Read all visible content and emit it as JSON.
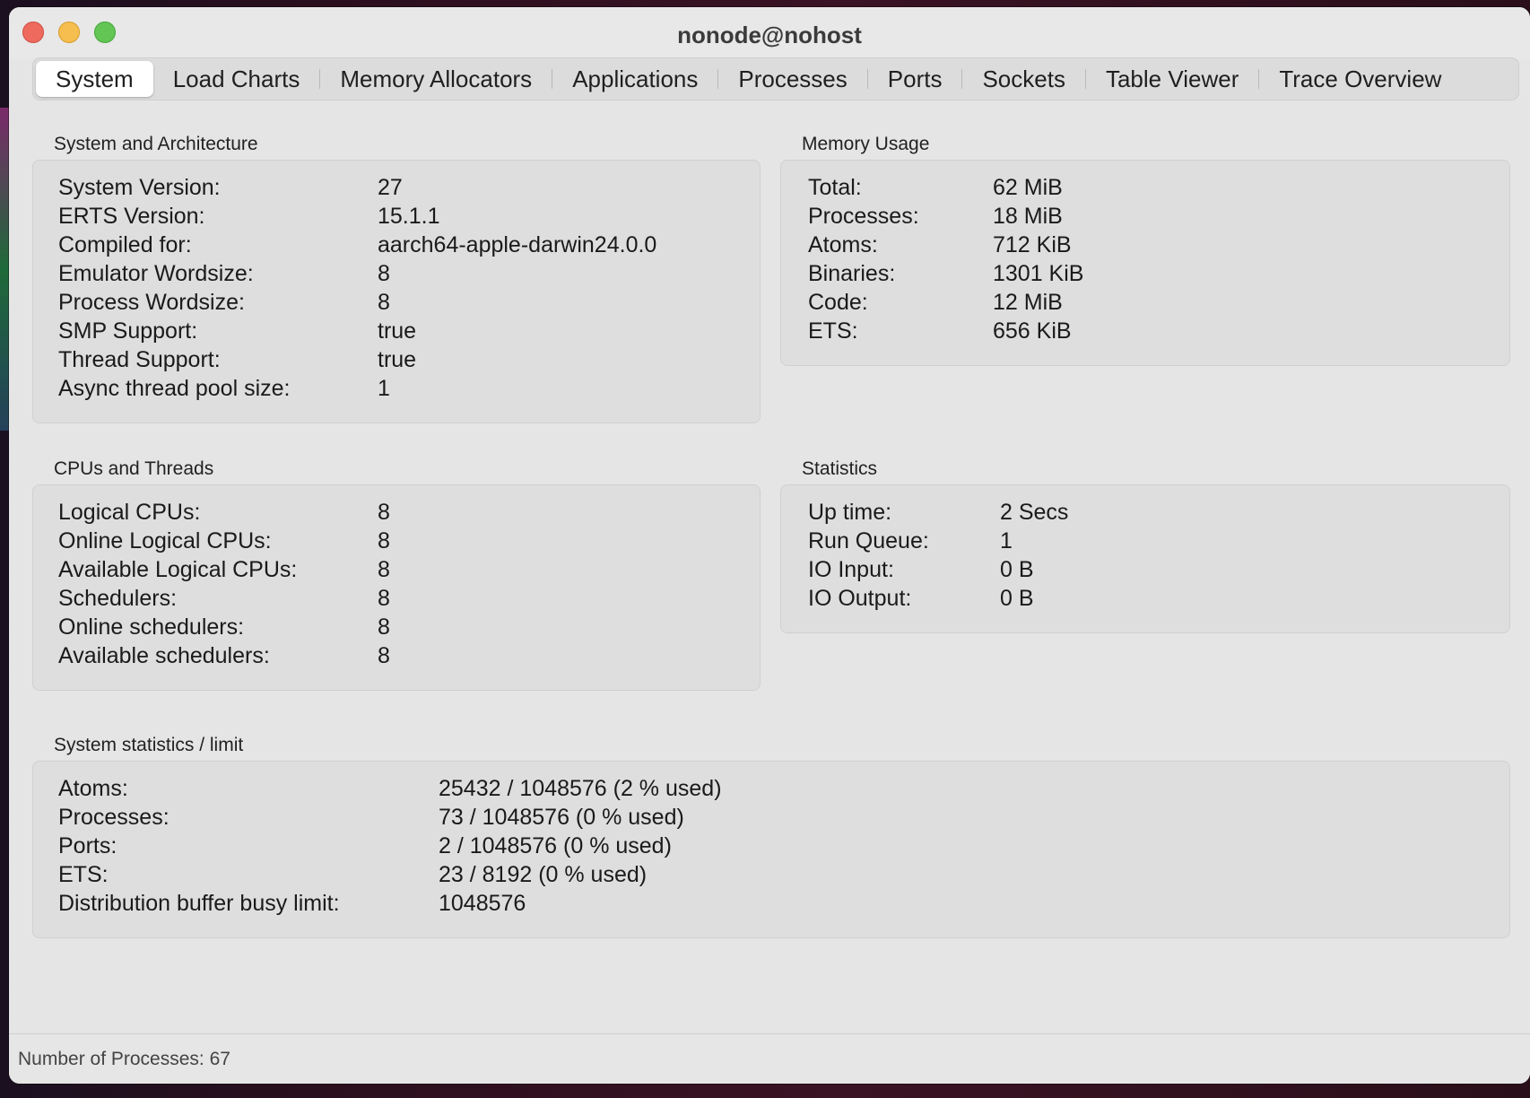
{
  "window": {
    "title": "nonode@nohost"
  },
  "tabs": [
    {
      "label": "System"
    },
    {
      "label": "Load Charts"
    },
    {
      "label": "Memory Allocators"
    },
    {
      "label": "Applications"
    },
    {
      "label": "Processes"
    },
    {
      "label": "Ports"
    },
    {
      "label": "Sockets"
    },
    {
      "label": "Table Viewer"
    },
    {
      "label": "Trace Overview"
    }
  ],
  "active_tab": "System",
  "system_arch": {
    "title": "System and Architecture",
    "rows": [
      {
        "label": "System Version:",
        "value": "27"
      },
      {
        "label": "ERTS Version:",
        "value": "15.1.1"
      },
      {
        "label": "Compiled for:",
        "value": "aarch64-apple-darwin24.0.0"
      },
      {
        "label": "Emulator Wordsize:",
        "value": "8"
      },
      {
        "label": "Process Wordsize:",
        "value": "8"
      },
      {
        "label": "SMP Support:",
        "value": "true"
      },
      {
        "label": "Thread Support:",
        "value": "true"
      },
      {
        "label": "Async thread pool size:",
        "value": "1"
      }
    ]
  },
  "memory_usage": {
    "title": "Memory Usage",
    "rows": [
      {
        "label": "Total:",
        "value": "62 MiB"
      },
      {
        "label": "Processes:",
        "value": "18 MiB"
      },
      {
        "label": "Atoms:",
        "value": "712 KiB"
      },
      {
        "label": "Binaries:",
        "value": "1301 KiB"
      },
      {
        "label": "Code:",
        "value": "12 MiB"
      },
      {
        "label": "ETS:",
        "value": "656 KiB"
      }
    ]
  },
  "cpus_threads": {
    "title": "CPUs and Threads",
    "rows": [
      {
        "label": "Logical CPUs:",
        "value": "8"
      },
      {
        "label": "Online Logical CPUs:",
        "value": "8"
      },
      {
        "label": "Available Logical CPUs:",
        "value": "8"
      },
      {
        "label": "Schedulers:",
        "value": "8"
      },
      {
        "label": "Online schedulers:",
        "value": "8"
      },
      {
        "label": "Available schedulers:",
        "value": "8"
      }
    ]
  },
  "statistics": {
    "title": "Statistics",
    "rows": [
      {
        "label": "Up time:",
        "value": "2 Secs"
      },
      {
        "label": "Run Queue:",
        "value": "1"
      },
      {
        "label": "IO Input:",
        "value": "0 B"
      },
      {
        "label": "IO Output:",
        "value": "0 B"
      }
    ]
  },
  "system_limits": {
    "title": "System statistics / limit",
    "rows": [
      {
        "label": "Atoms:",
        "value": "25432 / 1048576 (2 % used)"
      },
      {
        "label": "Processes:",
        "value": "73 / 1048576 (0 % used)"
      },
      {
        "label": "Ports:",
        "value": "2 / 1048576 (0 % used)"
      },
      {
        "label": "ETS:",
        "value": "23 / 8192 (0 % used)"
      },
      {
        "label": "Distribution buffer busy limit:",
        "value": "1048576"
      }
    ]
  },
  "statusbar": {
    "text": "Number of Processes: 67"
  }
}
